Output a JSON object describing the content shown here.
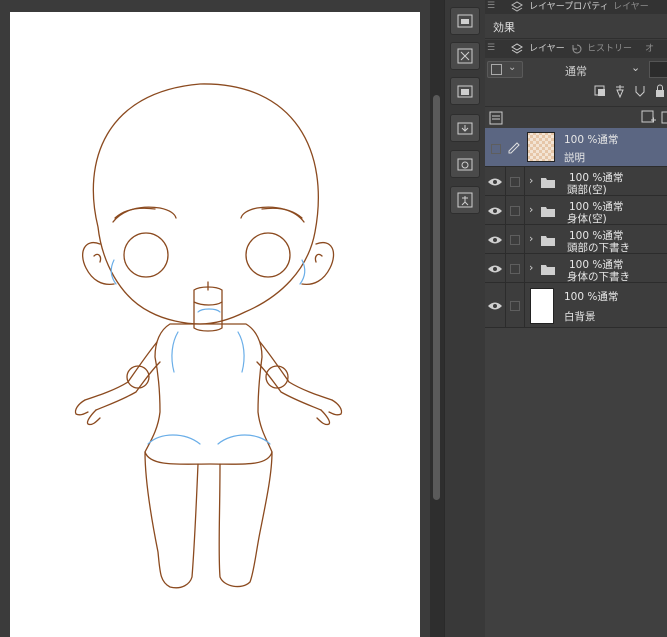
{
  "panels": {
    "layer_property_tab": "レイヤープロパティ",
    "layer_property_tab_2": "レイヤー",
    "effects_label": "効果",
    "layer_tab": "レイヤー",
    "history_tab": "ヒストリー",
    "other_tab": "オ"
  },
  "layer_toolbar": {
    "blend_mode": "通常"
  },
  "layers": [
    {
      "opacity_blend": "100 %通常",
      "name": "説明",
      "type": "raster",
      "selected": true,
      "visible": false
    },
    {
      "opacity_blend": "100 %通常",
      "name": "頭部(空)",
      "type": "folder",
      "selected": false,
      "visible": true
    },
    {
      "opacity_blend": "100 %通常",
      "name": "身体(空)",
      "type": "folder",
      "selected": false,
      "visible": true
    },
    {
      "opacity_blend": "100 %通常",
      "name": "頭部の下書き",
      "type": "folder",
      "selected": false,
      "visible": true
    },
    {
      "opacity_blend": "100 %通常",
      "name": "身体の下書き",
      "type": "folder",
      "selected": false,
      "visible": true
    },
    {
      "opacity_blend": "100 %通常",
      "name": "白背景",
      "type": "paper",
      "selected": false,
      "visible": true
    }
  ],
  "colors": {
    "sketch_line": "#8b4a1f",
    "guide_line": "#6aaee8",
    "selected_row": "#5b6682"
  }
}
